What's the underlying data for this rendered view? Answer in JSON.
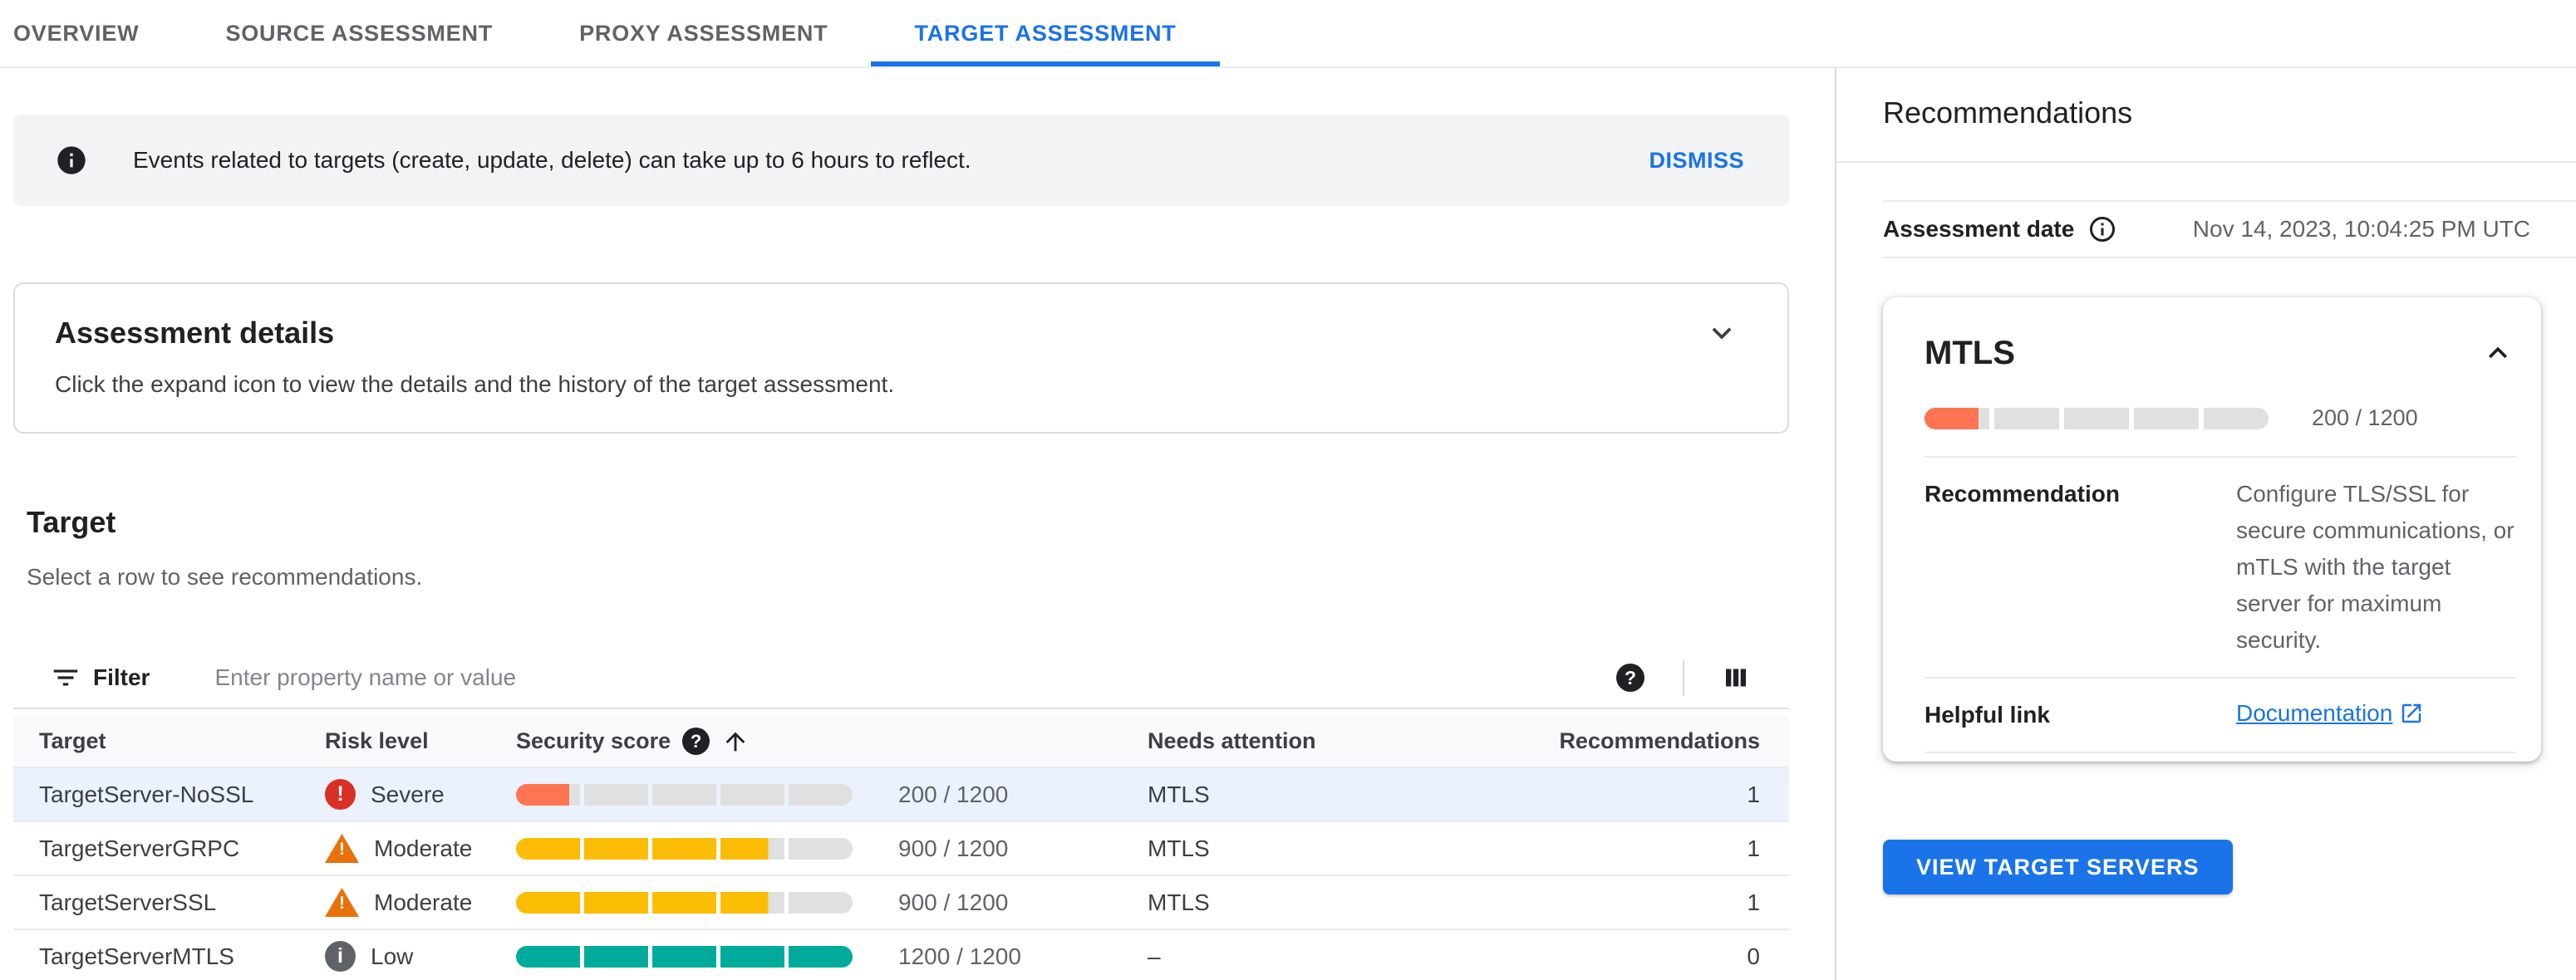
{
  "tabs": [
    {
      "label": "OVERVIEW",
      "active": false
    },
    {
      "label": "SOURCE ASSESSMENT",
      "active": false
    },
    {
      "label": "PROXY ASSESSMENT",
      "active": false
    },
    {
      "label": "TARGET ASSESSMENT",
      "active": true
    }
  ],
  "banner": {
    "text": "Events related to targets (create, update, delete) can take up to 6 hours to reflect.",
    "dismiss_label": "DISMISS"
  },
  "assessment_details": {
    "title": "Assessment details",
    "description": "Click the expand icon to view the details and the history of the target assessment."
  },
  "target_section": {
    "title": "Target",
    "subtitle": "Select a row to see recommendations."
  },
  "filter": {
    "label": "Filter",
    "placeholder": "Enter property name or value"
  },
  "table": {
    "columns": {
      "target": "Target",
      "risk": "Risk level",
      "score": "Security score",
      "needs_attention": "Needs attention",
      "recommendations": "Recommendations"
    },
    "rows": [
      {
        "target": "TargetServer-NoSSL",
        "risk_label": "Severe",
        "risk_icon": "error-icon",
        "score": 200,
        "score_max": 1200,
        "score_label": "200 / 1200",
        "bar_color": "#ff7452",
        "needs_attention": "MTLS",
        "recommendations": "1",
        "selected": true
      },
      {
        "target": "TargetServerGRPC",
        "risk_label": "Moderate",
        "risk_icon": "warning-icon",
        "score": 900,
        "score_max": 1200,
        "score_label": "900 / 1200",
        "bar_color": "#fbbc04",
        "needs_attention": "MTLS",
        "recommendations": "1",
        "selected": false
      },
      {
        "target": "TargetServerSSL",
        "risk_label": "Moderate",
        "risk_icon": "warning-icon",
        "score": 900,
        "score_max": 1200,
        "score_label": "900 / 1200",
        "bar_color": "#fbbc04",
        "needs_attention": "MTLS",
        "recommendations": "1",
        "selected": false
      },
      {
        "target": "TargetServerMTLS",
        "risk_label": "Low",
        "risk_icon": "info-icon",
        "score": 1200,
        "score_max": 1200,
        "score_label": "1200 / 1200",
        "bar_color": "#00ab9b",
        "needs_attention": "–",
        "recommendations": "0",
        "selected": false
      }
    ]
  },
  "recommendations_panel": {
    "title": "Recommendations",
    "assessment_date_label": "Assessment date",
    "assessment_date_value": "Nov 14, 2023, 10:04:25 PM UTC",
    "card": {
      "title": "MTLS",
      "score": 200,
      "score_max": 1200,
      "score_label": "200 / 1200",
      "bar_color": "#ff7452",
      "recommendation_label": "Recommendation",
      "recommendation_text": "Configure TLS/SSL for secure communications, or mTLS with the target server for maximum security.",
      "helpful_link_label": "Helpful link",
      "link_label": "Documentation"
    },
    "view_button_label": "VIEW TARGET SERVERS"
  },
  "colors": {
    "accent": "#1a73e8",
    "bar_empty": "#e0e0e0",
    "severe": "#d93025",
    "moderate": "#e8710a",
    "low": "#5f6368"
  }
}
